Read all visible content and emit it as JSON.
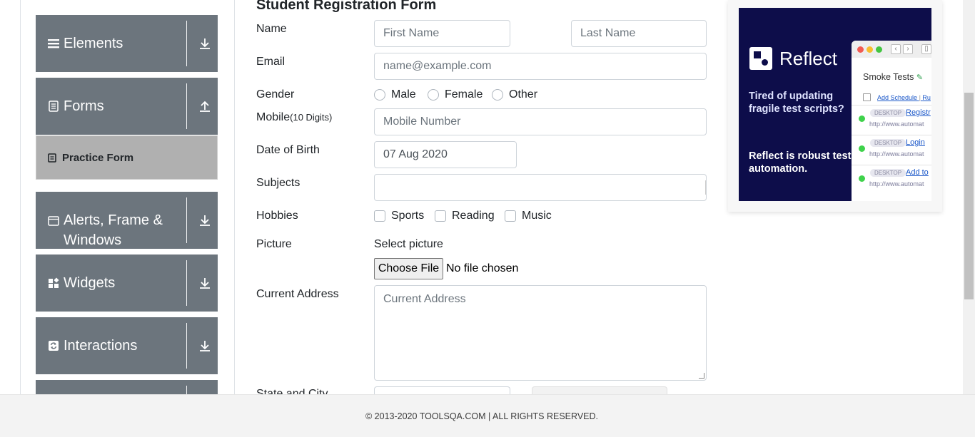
{
  "sidebar": {
    "groups": [
      {
        "label": "Elements",
        "icon": "hamburger-icon",
        "arrow": "download-arrow-icon"
      },
      {
        "label": "Forms",
        "icon": "document-icon",
        "arrow": "upload-arrow-icon"
      },
      {
        "label": "Alerts, Frame & Windows",
        "icon": "window-icon",
        "arrow": "download-arrow-icon"
      },
      {
        "label": "Widgets",
        "icon": "widgets-icon",
        "arrow": "download-arrow-icon"
      },
      {
        "label": "Interactions",
        "icon": "interactions-icon",
        "arrow": "download-arrow-icon"
      }
    ],
    "active_item": "Practice Form"
  },
  "form": {
    "title": "Student Registration Form",
    "name_label": "Name",
    "first_name_placeholder": "First Name",
    "last_name_placeholder": "Last Name",
    "email_label": "Email",
    "email_placeholder": "name@example.com",
    "gender_label": "Gender",
    "gender_options": [
      "Male",
      "Female",
      "Other"
    ],
    "mobile_label": "Mobile",
    "mobile_hint": "(10 Digits)",
    "mobile_placeholder": "Mobile Number",
    "dob_label": "Date of Birth",
    "dob_value": "07 Aug 2020",
    "subjects_label": "Subjects",
    "hobbies_label": "Hobbies",
    "hobbies_options": [
      "Sports",
      "Reading",
      "Music"
    ],
    "picture_label": "Picture",
    "select_picture": "Select picture",
    "choose_file": "Choose File",
    "no_file": "No file chosen",
    "address_label": "Current Address",
    "address_placeholder": "Current Address",
    "state_city_label": "State and City"
  },
  "ad": {
    "brand": "Reflect",
    "tagline": "Tired of updating fragile test scripts?",
    "pitch": "Reflect is robust test automation.",
    "panel_title": "Smoke Tests",
    "schedule": "Add Schedule",
    "schedule_more": "Ru",
    "rows": [
      {
        "tag": "DESKTOP",
        "link": "Registr",
        "url": "http://www.automat"
      },
      {
        "tag": "DESKTOP",
        "link": "Login",
        "url": "http://www.automat"
      },
      {
        "tag": "DESKTOP",
        "link": "Add to",
        "url": "http://www.automat"
      }
    ],
    "dot_colors": [
      "#f25b52",
      "#f7be2f",
      "#43c541"
    ]
  },
  "footer": {
    "text": "© 2013-2020 TOOLSQA.COM | ALL RIGHTS RESERVED."
  },
  "colors": {
    "group_bg": "#6c757d",
    "active_bg": "#b0b0b0",
    "ad_bg": "#0d0d4a"
  }
}
